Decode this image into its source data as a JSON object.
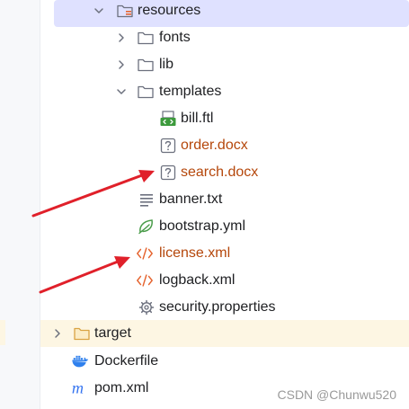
{
  "tree": {
    "items": [
      {
        "label": "resources"
      },
      {
        "label": "fonts"
      },
      {
        "label": "lib"
      },
      {
        "label": "templates"
      },
      {
        "label": "bill.ftl"
      },
      {
        "label": "order.docx"
      },
      {
        "label": "search.docx"
      },
      {
        "label": "banner.txt"
      },
      {
        "label": "bootstrap.yml"
      },
      {
        "label": "license.xml"
      },
      {
        "label": "logback.xml"
      },
      {
        "label": "security.properties"
      },
      {
        "label": "target"
      },
      {
        "label": "Dockerfile"
      },
      {
        "label": "pom.xml"
      }
    ]
  },
  "annotations": {
    "arrow_color": "#e0202a"
  },
  "colors": {
    "selection": "#dfe1ff",
    "excluded_row": "#fdf6e3",
    "modified_text": "#b5470b",
    "folder_icon": "#6c707e",
    "excluded_folder_icon": "#d9a343",
    "xml_icon": "#e5642f"
  },
  "watermark": {
    "text": "CSDN @Chunwu520"
  }
}
